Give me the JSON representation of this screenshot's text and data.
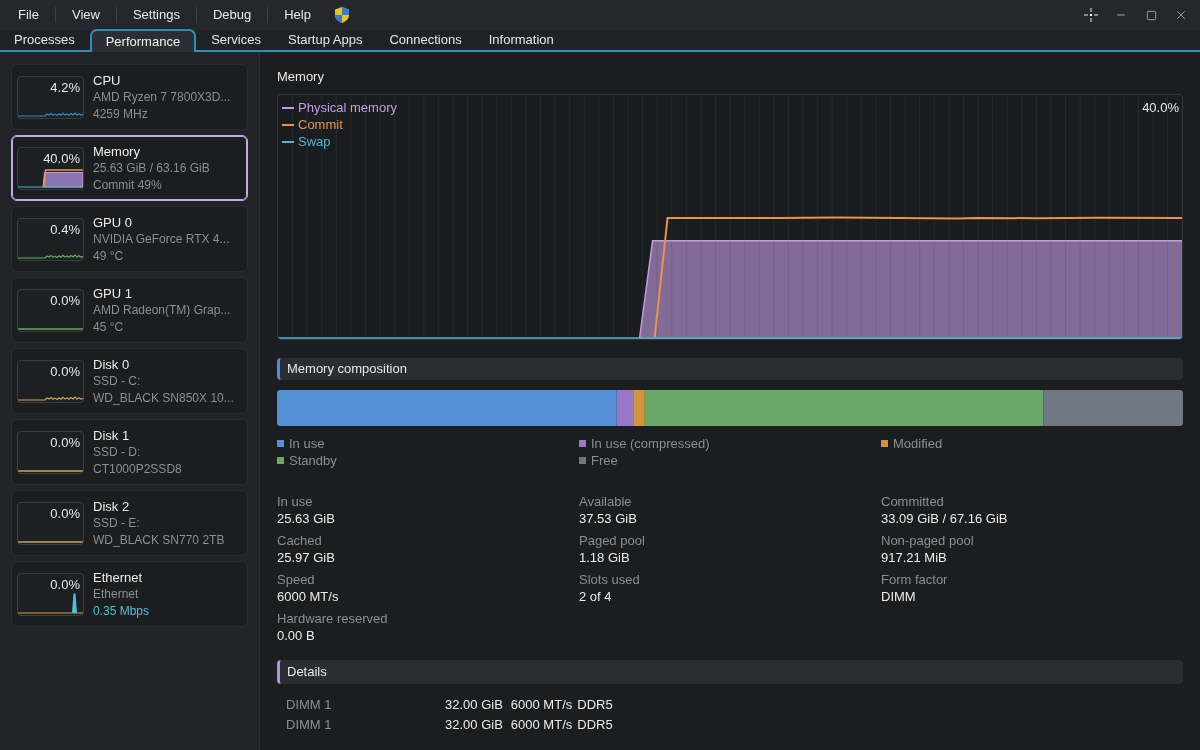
{
  "menu": [
    "File",
    "View",
    "Settings",
    "Debug",
    "Help"
  ],
  "tabs": [
    {
      "label": "Processes",
      "selected": false
    },
    {
      "label": "Performance",
      "selected": true
    },
    {
      "label": "Services",
      "selected": false
    },
    {
      "label": "Startup Apps",
      "selected": false
    },
    {
      "label": "Connections",
      "selected": false
    },
    {
      "label": "Information",
      "selected": false
    }
  ],
  "devices": [
    {
      "kind": "cpu",
      "active": true,
      "name": "CPU",
      "percent": "4.2%",
      "subtitle": "AMD Ryzen 7 7800X3D...",
      "detail": "4259 MHz",
      "selected": false
    },
    {
      "kind": "memory",
      "active": true,
      "name": "Memory",
      "percent": "40.0%",
      "subtitle": "25.63 GiB / 63.16 GiB",
      "detail": "Commit 49%",
      "selected": true
    },
    {
      "kind": "gpu",
      "active": true,
      "name": "GPU 0",
      "percent": "0.4%",
      "subtitle": "NVIDIA GeForce RTX 4...",
      "detail": "49 °C",
      "selected": false
    },
    {
      "kind": "gpu",
      "active": false,
      "name": "GPU 1",
      "percent": "0.0%",
      "subtitle": "AMD Radeon(TM) Grap...",
      "detail": "45 °C",
      "selected": false
    },
    {
      "kind": "disk",
      "active": true,
      "name": "Disk 0",
      "percent": "0.0%",
      "subtitle": "SSD - C:",
      "detail": "WD_BLACK SN850X 10...",
      "selected": false
    },
    {
      "kind": "disk",
      "active": false,
      "name": "Disk 1",
      "percent": "0.0%",
      "subtitle": "SSD - D:",
      "detail": "CT1000P2SSD8",
      "selected": false
    },
    {
      "kind": "disk",
      "active": false,
      "name": "Disk 2",
      "percent": "0.0%",
      "subtitle": "SSD - E:",
      "detail": "WD_BLACK SN770 2TB",
      "selected": false
    },
    {
      "kind": "network",
      "active": true,
      "name": "Ethernet",
      "percent": "0.0%",
      "subtitle": "Ethernet",
      "detail": "0.35 Mbps",
      "selected": false
    }
  ],
  "memory": {
    "title": "Memory",
    "chart": {
      "legend": [
        {
          "label": "Physical memory",
          "color": "#c39be0"
        },
        {
          "label": "Commit",
          "color": "#e8944a"
        },
        {
          "label": "Swap",
          "color": "#4cb8d0"
        }
      ],
      "reading": "40.0%"
    }
  },
  "composition": {
    "title": "Memory composition",
    "items": [
      {
        "label": "In use",
        "color": "#5590d6"
      },
      {
        "label": "In use (compressed)",
        "color": "#9a78c9"
      },
      {
        "label": "Modified",
        "color": "#d0963e"
      },
      {
        "label": "Standby",
        "color": "#6aa86a"
      },
      {
        "label": "Free",
        "color": "#6f7880"
      }
    ]
  },
  "stats": [
    {
      "label": "In use",
      "value": "25.63 GiB"
    },
    {
      "label": "Available",
      "value": "37.53 GiB"
    },
    {
      "label": "Committed",
      "value": "33.09 GiB / 67.16 GiB"
    },
    {
      "label": "Cached",
      "value": "25.97 GiB"
    },
    {
      "label": "Paged pool",
      "value": "1.18 GiB"
    },
    {
      "label": "Non-paged pool",
      "value": "917.21 MiB"
    },
    {
      "label": "Speed",
      "value": "6000 MT/s"
    },
    {
      "label": "Slots used",
      "value": "2 of 4"
    },
    {
      "label": "Form factor",
      "value": "DIMM"
    },
    {
      "label": "Hardware reserved",
      "value": "0.00 B"
    }
  ],
  "details": {
    "title": "Details",
    "rows": [
      {
        "slot": "DIMM 1",
        "size": "32.00 GiB",
        "speed": "6000 MT/s",
        "type": "DDR5"
      },
      {
        "slot": "DIMM 1",
        "size": "32.00 GiB",
        "speed": "6000 MT/s",
        "type": "DDR5"
      }
    ]
  }
}
